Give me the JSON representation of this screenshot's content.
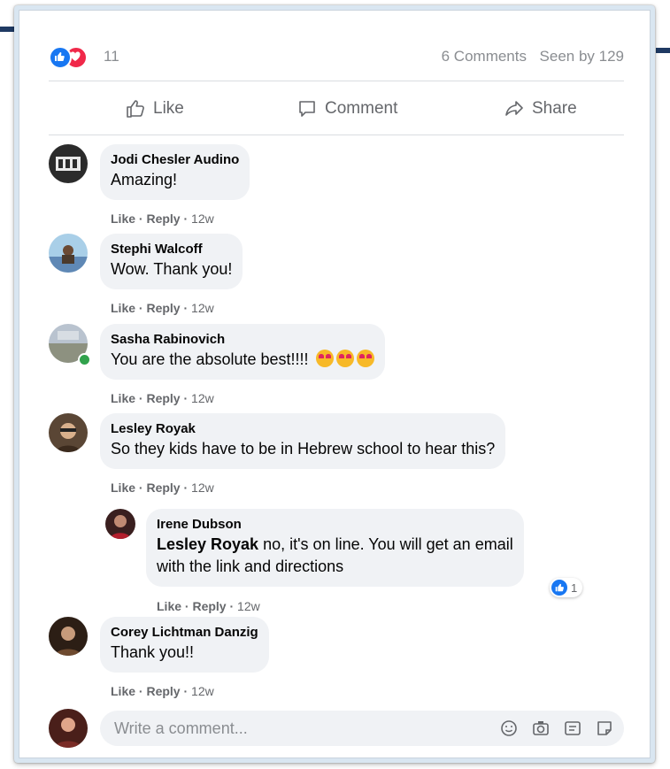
{
  "colors": {
    "accent": "#1877f2",
    "love": "#f02849",
    "bubble": "#f0f2f5",
    "text_secondary": "#65676b",
    "frame": "#d9e6f1",
    "deco": "#1f3a63"
  },
  "post_stats": {
    "reaction_icons": [
      "like-icon",
      "love-icon"
    ],
    "reaction_count": "11",
    "comments_count": "6 Comments",
    "seen_by": "Seen by 129"
  },
  "actions": {
    "like": {
      "label": "Like",
      "icon": "thumbs-up-icon"
    },
    "comment": {
      "label": "Comment",
      "icon": "speech-bubble-icon"
    },
    "share": {
      "label": "Share",
      "icon": "share-arrow-icon"
    }
  },
  "comments": [
    {
      "author": "Jodi Chesler Audino",
      "text": "Amazing!",
      "actions": {
        "like": "Like",
        "reply": "Reply",
        "time": "12w"
      }
    },
    {
      "author": "Stephi Walcoff",
      "text": "Wow. Thank you!",
      "actions": {
        "like": "Like",
        "reply": "Reply",
        "time": "12w"
      }
    },
    {
      "author": "Sasha Rabinovich",
      "text": "You are the absolute best!!!!",
      "emoji": "heart-eyes-emoji",
      "actions": {
        "like": "Like",
        "reply": "Reply",
        "time": "12w"
      }
    },
    {
      "author": "Lesley Royak",
      "text": "So they kids have to be in Hebrew school to hear this?",
      "actions": {
        "like": "Like",
        "reply": "Reply",
        "time": "12w"
      },
      "reply": {
        "author": "Irene Dubson",
        "mention": "Lesley Royak",
        "text_line1": "no, it's on line. You will get an email",
        "text_line2": "with the link and directions",
        "reaction_count": "1",
        "actions": {
          "like": "Like",
          "reply": "Reply",
          "time": "12w"
        }
      }
    },
    {
      "author": "Corey Lichtman Danzig",
      "text": "Thank you!!",
      "actions": {
        "like": "Like",
        "reply": "Reply",
        "time": "12w"
      }
    }
  ],
  "composer": {
    "placeholder": "Write a comment...",
    "icons": [
      "emoji-icon",
      "camera-icon",
      "gif-icon",
      "sticker-icon"
    ]
  }
}
